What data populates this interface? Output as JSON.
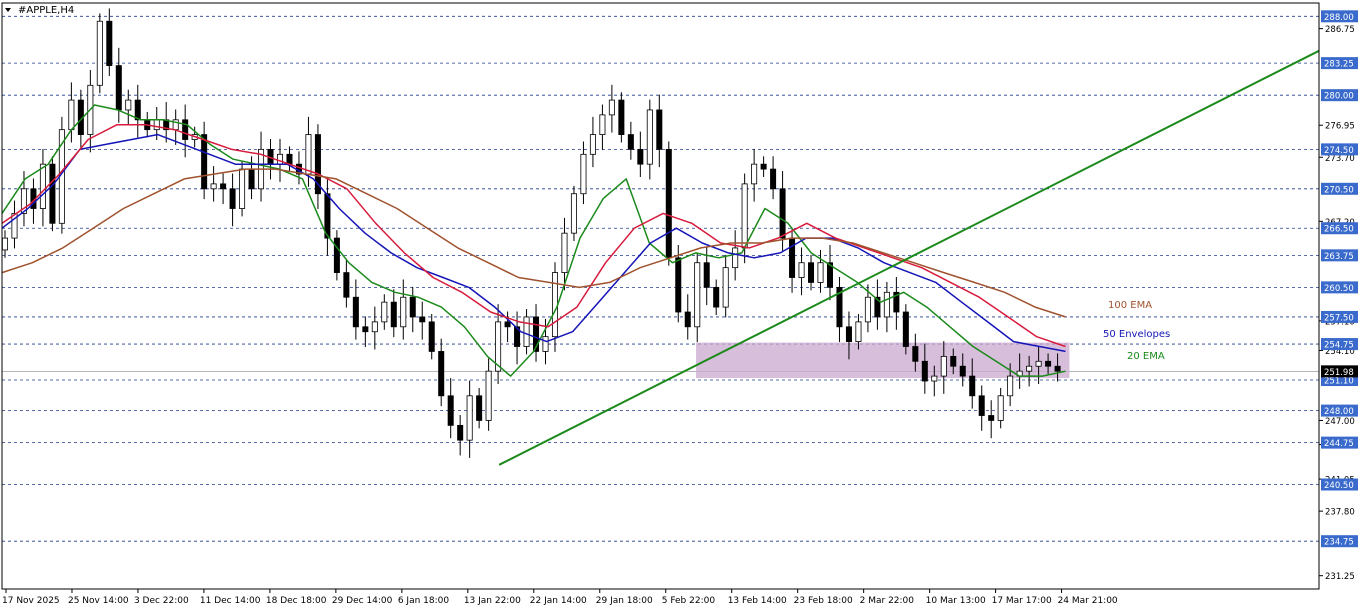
{
  "symbol_title": "#APPLE,H4",
  "colors": {
    "background": "#ffffff",
    "grid": "#1f3a8a",
    "axis": "#000000",
    "candle": "#000000",
    "ema20": "#1b8a1b",
    "envelopes50": "#1515b8",
    "envelopes50_upper": "#d81b3c",
    "ema100": "#a0522d",
    "trendline": "#1b8a1b",
    "zone_fill": "#c9a8cf",
    "price_label_bg": "#3a6bcc",
    "price_label_text": "#ffffff",
    "current_price_bg": "#000000"
  },
  "annotations": [
    {
      "text": "100 EMA",
      "color": "#a0522d",
      "series": "ema100"
    },
    {
      "text": "50 Envelopes",
      "color": "#1515b8",
      "series": "envelopes50"
    },
    {
      "text": "20 EMA",
      "color": "#1b8a1b",
      "series": "ema20"
    }
  ],
  "chart_data": {
    "type": "candlestick",
    "title": "#APPLE,H4",
    "ylim": [
      229.9,
      289.35
    ],
    "x_tick_labels": [
      "17 Nov 2025",
      "25 Nov 14:00",
      "3 Dec 22:00",
      "11 Dec 14:00",
      "18 Dec 18:00",
      "29 Dec 14:00",
      "6 Jan 18:00",
      "13 Jan 22:00",
      "22 Jan 14:00",
      "29 Jan 18:00",
      "5 Feb 22:00",
      "13 Feb 14:00",
      "23 Feb 18:00",
      "2 Mar 22:00",
      "10 Mar 13:00",
      "17 Mar 17:00",
      "24 Mar 21:00"
    ],
    "y_tick_labels": [
      "286.75",
      "276.95",
      "273.70",
      "267.20",
      "257.10",
      "254.10",
      "247.00",
      "244.55",
      "241.05",
      "237.80",
      "231.25"
    ],
    "price_levels": [
      "288.00",
      "283.25",
      "280.00",
      "274.50",
      "270.50",
      "266.50",
      "263.75",
      "260.50",
      "257.50",
      "254.75",
      "251.10",
      "248.00",
      "244.75",
      "240.50",
      "234.75"
    ],
    "current_price": "251.98",
    "close_series": [
      265.5,
      268.0,
      270.5,
      268.5,
      273.0,
      267.0,
      276.5,
      279.5,
      276.0,
      281.0,
      287.5,
      283.0,
      278.5,
      279.5,
      277.5,
      276.5,
      277.5,
      276.5,
      277.5,
      275.5,
      276.0,
      270.5,
      271.0,
      270.5,
      268.5,
      272.5,
      270.5,
      274.5,
      273.0,
      274.0,
      273.0,
      272.0,
      276.0,
      270.0,
      265.5,
      262.0,
      259.5,
      256.5,
      256.0,
      257.0,
      259.0,
      256.5,
      259.5,
      257.5,
      257.0,
      254.0,
      249.5,
      246.5,
      245.0,
      249.5,
      247.0,
      252.0,
      257.0,
      256.5,
      254.5,
      257.5,
      254.0,
      255.5,
      262.0,
      266.0,
      270.0,
      274.0,
      276.0,
      278.0,
      279.5,
      276.0,
      274.5,
      273.0,
      278.5,
      274.5,
      263.5,
      258.0,
      256.5,
      263.0,
      260.5,
      258.5,
      262.5,
      264.5,
      271.0,
      273.0,
      272.5,
      270.5,
      265.5,
      261.5,
      263.0,
      261.0,
      263.0,
      260.5,
      256.5,
      255.0,
      257.0,
      259.5,
      257.5,
      260.0,
      258.0,
      254.5,
      253.0,
      251.0,
      251.5,
      253.5,
      252.5,
      251.5,
      249.5,
      247.5,
      247.0,
      249.5,
      251.5,
      252.0,
      252.5,
      253.0,
      252.5,
      252.0
    ],
    "series": [
      {
        "name": "20 EMA",
        "values": [
          268.0,
          271.5,
          273.0,
          276.5,
          279.0,
          278.5,
          277.5,
          277.5,
          277.0,
          275.0,
          273.5,
          273.0,
          272.5,
          271.5,
          266.0,
          263.0,
          261.0,
          260.0,
          259.5,
          258.5,
          256.5,
          253.5,
          251.5,
          254.0,
          258.5,
          265.5,
          269.5,
          271.5,
          265.0,
          263.0,
          264.0,
          263.5,
          264.0,
          268.5,
          267.0,
          264.0,
          262.5,
          261.0,
          259.0,
          260.0,
          258.5,
          256.5,
          254.5,
          253.0,
          251.5,
          251.5,
          252.0
        ]
      },
      {
        "name": "50 Envelopes",
        "values": [
          266.5,
          268.5,
          271.0,
          274.5,
          275.0,
          275.5,
          276.0,
          275.0,
          274.0,
          273.0,
          273.0,
          273.0,
          271.5,
          268.5,
          266.0,
          264.0,
          262.5,
          261.5,
          260.5,
          258.5,
          256.0,
          255.0,
          256.0,
          259.0,
          262.0,
          265.0,
          266.5,
          265.0,
          264.0,
          263.5,
          264.0,
          265.5,
          265.5,
          264.5,
          263.0,
          262.0,
          261.0,
          259.0,
          257.0,
          255.0,
          254.5,
          254.0
        ]
      },
      {
        "name": "50 Envelopes upper",
        "values": [
          267.0,
          269.0,
          272.0,
          275.5,
          277.0,
          277.0,
          276.5,
          275.5,
          274.5,
          274.0,
          273.0,
          272.0,
          270.5,
          267.0,
          264.0,
          261.5,
          260.0,
          258.0,
          257.0,
          256.5,
          258.5,
          263.0,
          266.5,
          268.0,
          267.0,
          265.0,
          264.5,
          265.5,
          267.0,
          265.5,
          264.5,
          263.5,
          262.5,
          261.0,
          259.5,
          257.5,
          255.5,
          254.5
        ]
      },
      {
        "name": "100 EMA",
        "values": [
          262.0,
          263.0,
          264.5,
          266.5,
          268.5,
          270.0,
          271.5,
          272.0,
          272.5,
          272.5,
          272.0,
          271.5,
          270.0,
          268.5,
          266.5,
          264.5,
          263.0,
          261.5,
          261.0,
          260.5,
          261.0,
          262.5,
          263.5,
          264.5,
          265.0,
          265.0,
          265.5,
          265.5,
          265.0,
          264.0,
          263.0,
          262.0,
          261.0,
          260.0,
          258.5,
          257.5
        ]
      },
      {
        "name": "trendline",
        "values": [
          242.5,
          284.5
        ]
      }
    ],
    "zone": {
      "from": 251.3,
      "to": 254.9
    }
  }
}
